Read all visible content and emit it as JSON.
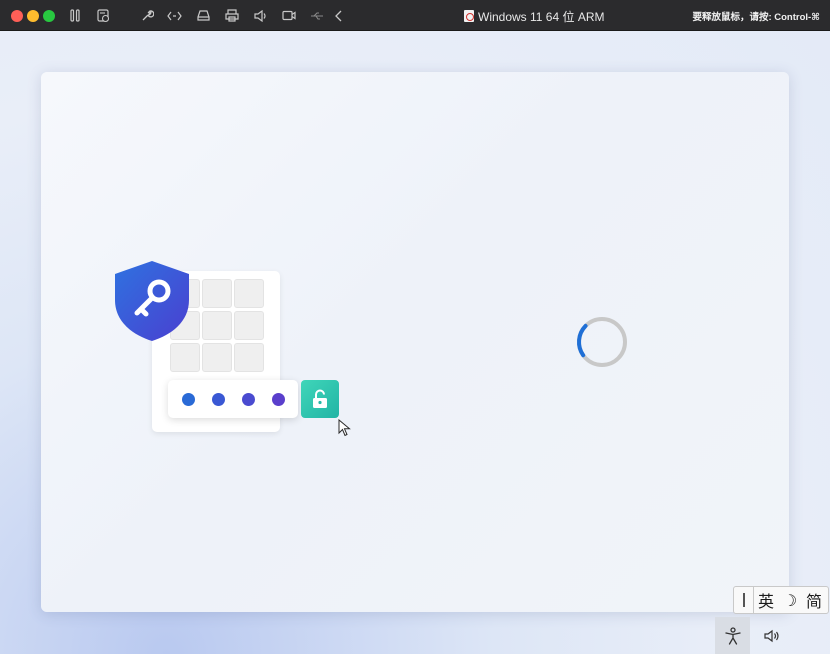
{
  "window": {
    "title": "Windows 11 64 位 ARM",
    "release_hint": "要释放鼠标，请按: Control-⌘"
  },
  "titlebar": {
    "buttons": [
      "close",
      "minimize",
      "maximize"
    ],
    "toolbar_icons": [
      "pause-icon",
      "snapshot-icon",
      "settings-wrench-icon",
      "code-icon",
      "hard-disk-icon",
      "printer-icon",
      "speaker-icon",
      "camera-icon",
      "usb-icon",
      "back-chevron-icon"
    ]
  },
  "setup": {
    "illustration": "windows-hello-pin",
    "pin_dot_colors": [
      "#2a6ad6",
      "#3a58d4",
      "#4a4bd0",
      "#5a3fcc"
    ],
    "shield_color": "#2f5fd8",
    "unlock_color": "#2bc2ab",
    "spinner_color": "#1f6fd6",
    "spinner_progress": 0.22
  },
  "ime": {
    "mode": "英",
    "moon": "☽",
    "variant": "简"
  },
  "taskbar": {
    "accessibility": "accessibility-icon",
    "volume": "volume-icon"
  }
}
